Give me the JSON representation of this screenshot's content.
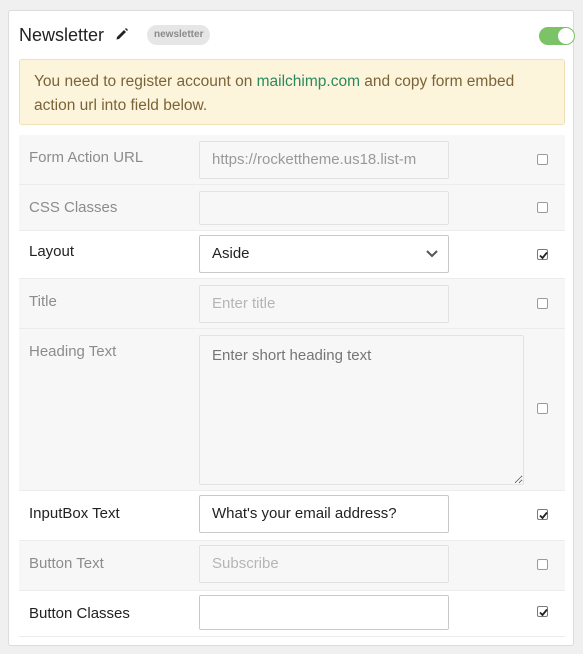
{
  "header": {
    "title": "Newsletter",
    "badge": "newsletter",
    "toggle_on": true
  },
  "alert": {
    "text_before": "You need to register account on ",
    "link": "mailchimp.com",
    "text_after": " and copy form embed action url into field below."
  },
  "fields": {
    "form_action_url": {
      "label": "Form Action URL",
      "value": "https://rockettheme.us18.list-m",
      "checked": false
    },
    "css_classes": {
      "label": "CSS Classes",
      "value": "",
      "checked": false
    },
    "layout": {
      "label": "Layout",
      "value": "Aside",
      "checked": true
    },
    "title": {
      "label": "Title",
      "placeholder": "Enter title",
      "checked": false
    },
    "heading_text": {
      "label": "Heading Text",
      "placeholder": "Enter short heading text",
      "checked": false
    },
    "inputbox_text": {
      "label": "InputBox Text",
      "value": "What's your email address?",
      "checked": true
    },
    "button_text": {
      "label": "Button Text",
      "placeholder": "Subscribe",
      "checked": false
    },
    "button_classes": {
      "label": "Button Classes",
      "value": "",
      "checked": true
    }
  },
  "colors": {
    "toggle_on": "#7cc266",
    "alert_bg": "#fdf4dc",
    "link": "#2a8a5e"
  }
}
